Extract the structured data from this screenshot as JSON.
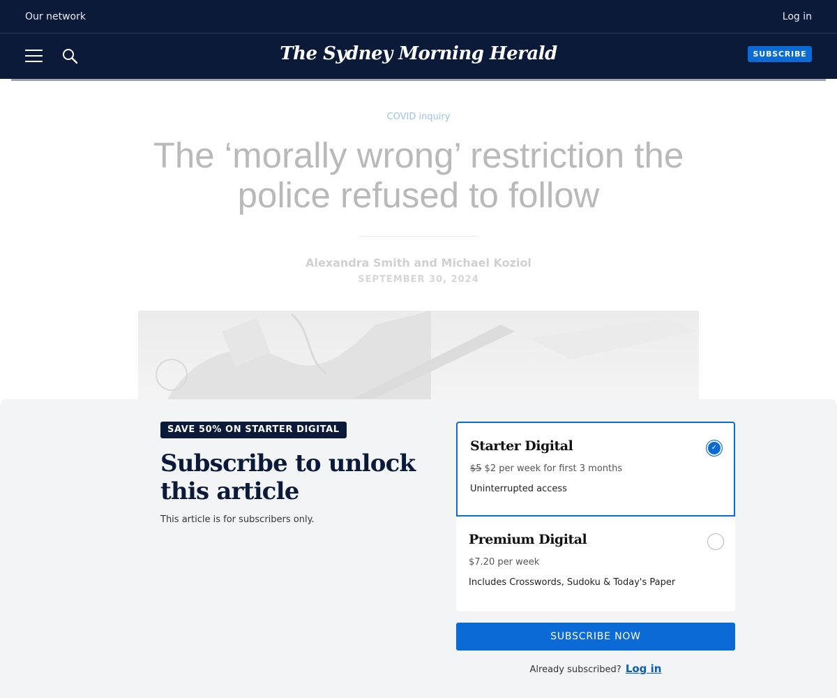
{
  "network_bar": {
    "network_label": "Our network",
    "login_label": "Log in"
  },
  "masthead": {
    "menu_icon": "hamburger-menu-icon",
    "search_icon": "search-icon",
    "logo_text": "The Sydney Morning Herald",
    "subscribe_label": "SUBSCRIBE"
  },
  "article": {
    "category": "COVID inquiry",
    "headline": "The ‘morally wrong’ restriction the police refused to follow",
    "byline": "Alexandra Smith and Michael Koziol",
    "date": "SEPTEMBER 30, 2024"
  },
  "paywall": {
    "badge": "SAVE 50% ON STARTER DIGITAL",
    "title": "Subscribe to unlock this article",
    "subtitle": "This article is for subscribers only.",
    "plans": [
      {
        "name": "Starter Digital",
        "old_price": "$5",
        "price": "$2 per week for first 3 months",
        "description": "Uninterrupted access",
        "selected": true
      },
      {
        "name": "Premium Digital",
        "price": "$7.20 per week",
        "description": "Includes Crosswords, Sudoku & Today's Paper",
        "selected": false
      }
    ],
    "cta_label": "SUBSCRIBE NOW",
    "already_text": "Already subscribed?",
    "login_label": "Log in"
  },
  "colors": {
    "navy": "#0c1a3a",
    "accent_blue": "#0a6ad6",
    "paywall_bg": "#f2f4f6"
  }
}
